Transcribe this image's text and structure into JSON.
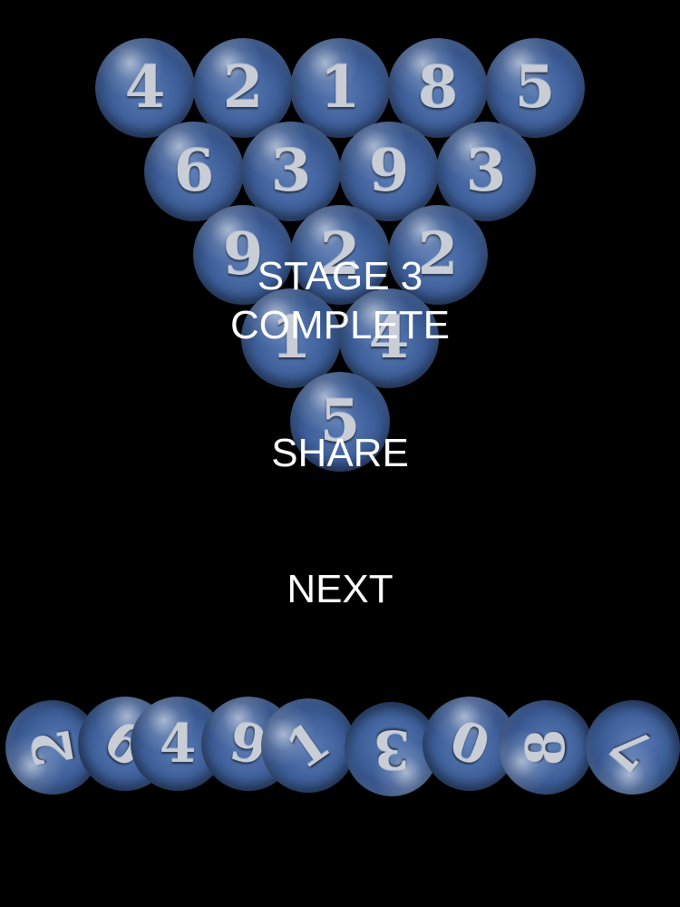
{
  "triangle_balls": [
    "4",
    "2",
    "1",
    "8",
    "5",
    "6",
    "3",
    "9",
    "3",
    "9",
    "2",
    "2",
    "1",
    "4",
    "5"
  ],
  "stage_text": {
    "line1": "STAGE 3",
    "line2": "COMPLETE"
  },
  "buttons": {
    "share": "SHARE",
    "next": "NEXT"
  },
  "bottom_balls": [
    "2",
    "6",
    "4",
    "9",
    "1",
    "3",
    "0",
    "8",
    "7"
  ],
  "colors": {
    "background": "#000000",
    "ball": "#3e5f99",
    "text": "#ffffff"
  }
}
